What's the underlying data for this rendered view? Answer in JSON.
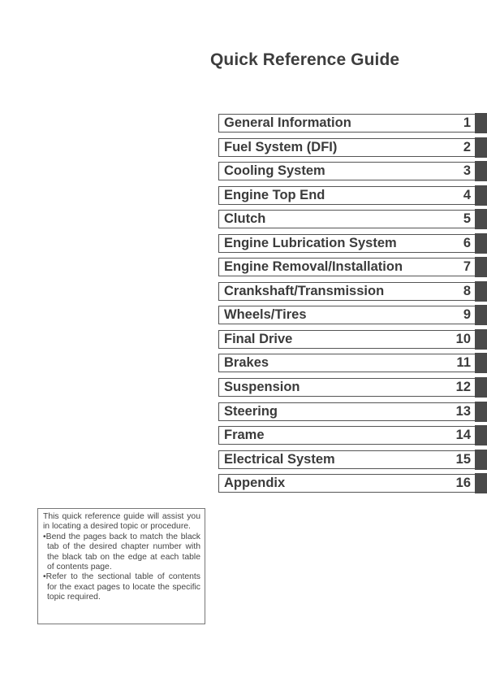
{
  "page": {
    "title": "Quick Reference Guide"
  },
  "toc": {
    "accent_tab_color": "#4a4a4a",
    "items": [
      {
        "label": "General Information",
        "number": "1"
      },
      {
        "label": "Fuel System (DFI)",
        "number": "2"
      },
      {
        "label": "Cooling System",
        "number": "3"
      },
      {
        "label": "Engine Top End",
        "number": "4"
      },
      {
        "label": "Clutch",
        "number": "5"
      },
      {
        "label": "Engine Lubrication System",
        "number": "6"
      },
      {
        "label": "Engine Removal/Installation",
        "number": "7"
      },
      {
        "label": "Crankshaft/Transmission",
        "number": "8"
      },
      {
        "label": "Wheels/Tires",
        "number": "9"
      },
      {
        "label": "Final Drive",
        "number": "10"
      },
      {
        "label": "Brakes",
        "number": "11"
      },
      {
        "label": "Suspension",
        "number": "12"
      },
      {
        "label": "Steering",
        "number": "13"
      },
      {
        "label": "Frame",
        "number": "14"
      },
      {
        "label": "Electrical System",
        "number": "15"
      },
      {
        "label": "Appendix",
        "number": "16"
      }
    ]
  },
  "note": {
    "intro": "This quick reference guide will assist you in locating a desired topic or procedure.",
    "bullets": [
      "•Bend the pages back to match the black tab of the desired chapter number with the black tab on the edge at each table of contents page.",
      "•Refer to the sectional table of contents for the exact pages to locate the specific topic required."
    ]
  }
}
